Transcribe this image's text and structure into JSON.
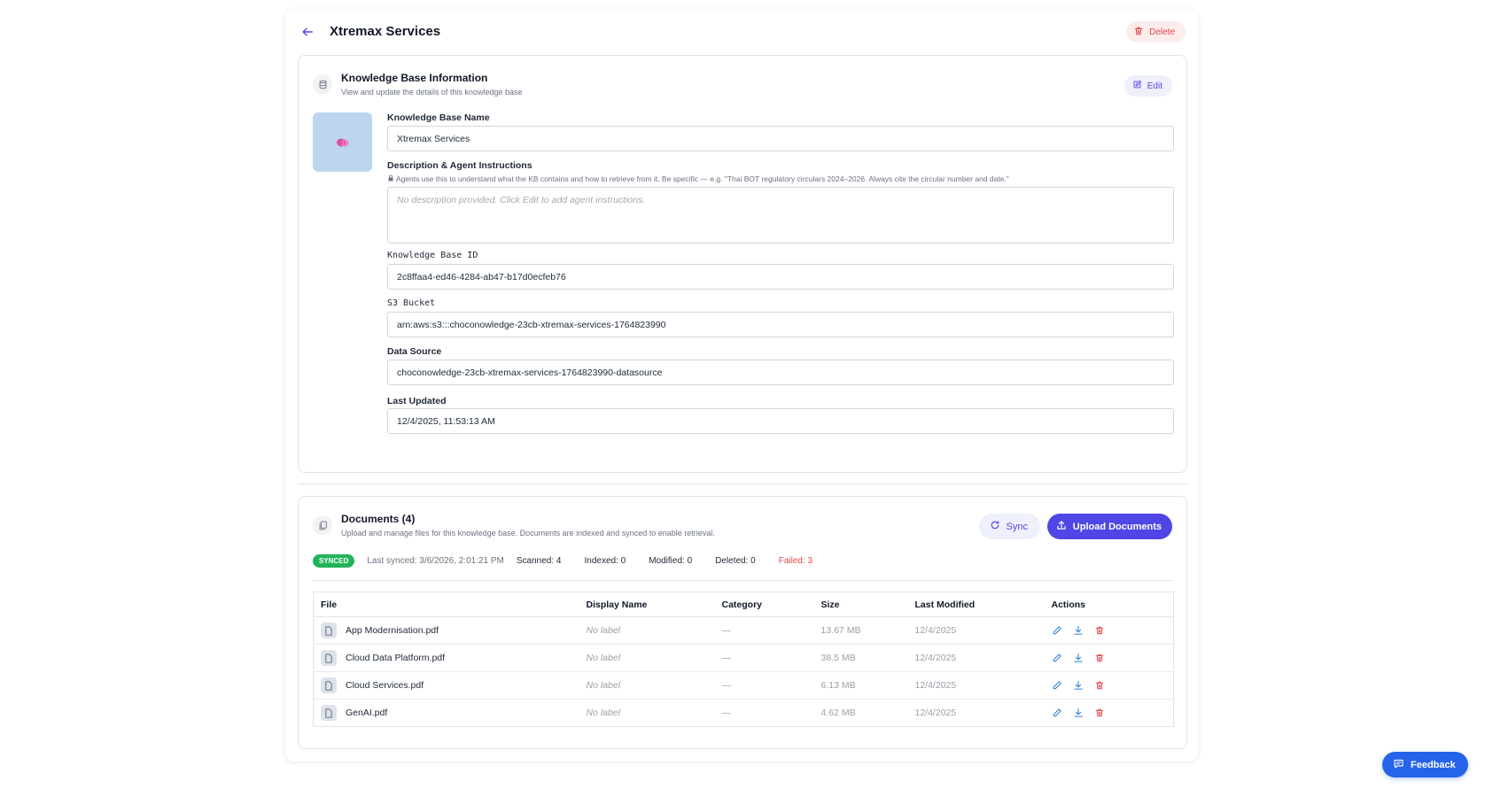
{
  "header": {
    "title": "Xtremax Services",
    "delete_label": "Delete"
  },
  "kb_info": {
    "title": "Knowledge Base Information",
    "subtitle": "View and update the details of this knowledge base",
    "edit_label": "Edit",
    "avatar_icon": "brain-icon",
    "fields": {
      "name_label": "Knowledge Base Name",
      "name_value": "Xtremax Services",
      "description_label": "Description & Agent Instructions",
      "description_hint": "Agents use this to understand what the KB contains and how to retrieve from it. Be specific — e.g. \"Thai BOT regulatory circulars 2024–2026. Always cite the circular number and date.\"",
      "description_placeholder": "No description provided. Click Edit to add agent instructions.",
      "id_label": "Knowledge Base ID",
      "id_value": "2c8ffaa4-ed46-4284-ab47-b17d0ecfeb76",
      "s3_label": "S3 Bucket",
      "s3_value": "arn:aws:s3:::choconowledge-23cb-xtremax-services-1764823990",
      "datasource_label": "Data Source",
      "datasource_value": "choconowledge-23cb-xtremax-services-1764823990-datasource",
      "updated_label": "Last Updated",
      "updated_value": "12/4/2025, 11:53:13 AM"
    }
  },
  "documents": {
    "title": "Documents (4)",
    "subtitle": "Upload and manage files for this knowledge base. Documents are indexed and synced to enable retrieval.",
    "sync_label": "Sync",
    "upload_label": "Upload Documents",
    "status": {
      "badge": "SYNCED",
      "last_synced": "Last synced: 3/6/2026, 2:01:21 PM",
      "scanned": "Scanned: 4",
      "indexed": "Indexed: 0",
      "modified": "Modified: 0",
      "deleted": "Deleted: 0",
      "failed": "Failed: 3"
    },
    "columns": [
      "File",
      "Display Name",
      "Category",
      "Size",
      "Last Modified",
      "Actions"
    ],
    "rows": [
      {
        "file": "App Modernisation.pdf",
        "display_name": "No label",
        "category": "—",
        "size": "13.67 MB",
        "modified": "12/4/2025"
      },
      {
        "file": "Cloud Data Platform.pdf",
        "display_name": "No label",
        "category": "—",
        "size": "38.5 MB",
        "modified": "12/4/2025"
      },
      {
        "file": "Cloud Services.pdf",
        "display_name": "No label",
        "category": "—",
        "size": "6.13 MB",
        "modified": "12/4/2025"
      },
      {
        "file": "GenAI.pdf",
        "display_name": "No label",
        "category": "—",
        "size": "4.62 MB",
        "modified": "12/4/2025"
      }
    ]
  },
  "feedback": {
    "label": "Feedback"
  },
  "colors": {
    "accent": "#4f46e5",
    "danger": "#e0454b",
    "success": "#22b35a",
    "feedback": "#2563eb"
  }
}
